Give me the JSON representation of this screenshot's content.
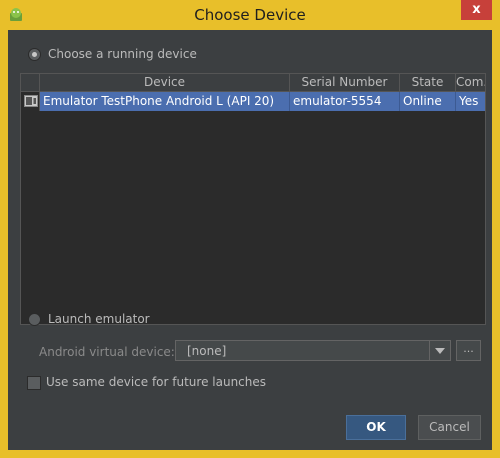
{
  "window": {
    "title": "Choose Device",
    "close_glyph": "x"
  },
  "running": {
    "label": "Choose a running device",
    "selected": true
  },
  "table": {
    "headers": [
      "Device",
      "Serial Number",
      "State",
      "Com..."
    ],
    "rows": [
      {
        "device": "Emulator TestPhone Android L (API 20)",
        "serial": "emulator-5554",
        "state": "Online",
        "compatible": "Yes"
      }
    ]
  },
  "launch": {
    "label": "Launch emulator",
    "selected": false,
    "avd_label": "Android virtual device:",
    "avd_value": "[none]",
    "browse_label": "..."
  },
  "same_device": {
    "label": "Use same device for future launches",
    "checked": false
  },
  "buttons": {
    "ok": "OK",
    "cancel": "Cancel"
  },
  "colors": {
    "title_bar": "#e8bf2a",
    "selection": "#4b6eaf",
    "background": "#3c3f41"
  }
}
